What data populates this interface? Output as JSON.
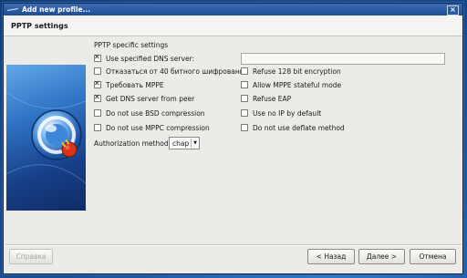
{
  "window": {
    "title": "Add new profile..."
  },
  "header": {
    "title": "PPTP settings"
  },
  "settings": {
    "group_title": "PPTP specific settings",
    "dns_checkbox": {
      "label": "Use specified DNS server:",
      "checked": true
    },
    "dns_value": "",
    "left_options": [
      {
        "label": "Отказаться от 40 битного шифрования",
        "checked": false
      },
      {
        "label": "Требовать MPPE",
        "checked": true
      },
      {
        "label": "Get DNS server from peer",
        "checked": true
      },
      {
        "label": "Do not use BSD compression",
        "checked": false
      },
      {
        "label": "Do not use MPPC compression",
        "checked": false
      }
    ],
    "right_options": [
      {
        "label": "Refuse 128 bit encryption",
        "checked": false
      },
      {
        "label": "Allow MPPE stateful mode",
        "checked": false
      },
      {
        "label": "Refuse EAP",
        "checked": false
      },
      {
        "label": "Use no IP by default",
        "checked": false
      },
      {
        "label": "Do not use deflate method",
        "checked": false
      }
    ],
    "auth_label": "Authorization method:",
    "auth_value": "chap"
  },
  "buttons": {
    "help": "Справка",
    "back": "< Назад",
    "next": "Далее >",
    "cancel": "Отмена"
  },
  "colors": {
    "titlebar": "#1f4d94",
    "desktop": "#1d5aa6",
    "dialog_bg": "#ecebe8"
  }
}
